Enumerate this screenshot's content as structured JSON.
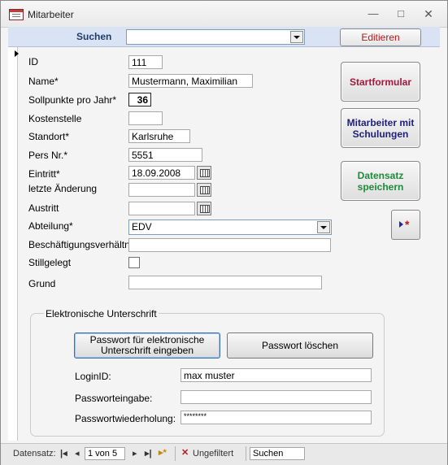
{
  "window": {
    "title": "Mitarbeiter",
    "minimize_glyph": "—",
    "maximize_glyph": "□",
    "close_glyph": "✕"
  },
  "header": {
    "search_label": "Suchen",
    "search_value": "",
    "edit_button": "Editieren"
  },
  "form": {
    "id": {
      "label": "ID",
      "value": "111"
    },
    "name": {
      "label": "Name*",
      "value": "Mustermann, Maximilian"
    },
    "sollpunkte": {
      "label": "Sollpunkte pro Jahr*",
      "value": "36"
    },
    "kostenstelle": {
      "label": "Kostenstelle",
      "value": ""
    },
    "standort": {
      "label": "Standort*",
      "value": "Karlsruhe"
    },
    "persnr": {
      "label": "Pers Nr.*",
      "value": "5551"
    },
    "eintritt": {
      "label": "Eintritt*",
      "value": "18.09.2008"
    },
    "letzte_aenderung": {
      "label": "letzte Änderung",
      "value": ""
    },
    "austritt": {
      "label": "Austritt",
      "value": ""
    },
    "abteilung": {
      "label": "Abteilung*",
      "value": "EDV"
    },
    "beschaeftigung": {
      "label": "Beschäftigungsverhältnis",
      "value": ""
    },
    "stillgelegt": {
      "label": "Stillgelegt",
      "checked": false
    },
    "grund": {
      "label": "Grund",
      "value": ""
    }
  },
  "side_buttons": {
    "startformular": "Startformular",
    "schulungen": "Mitarbeiter mit Schulungen",
    "speichern": "Datensatz speichern",
    "startformular_color": "#a3183c",
    "schulungen_color": "#1e1e7a",
    "speichern_color": "#1f8a3a",
    "new_record_icon": "new-record-icon"
  },
  "signature": {
    "group_title": "Elektronische Unterschrift",
    "enter_password_button": "Passwort für elektronische Unterschrift eingeben",
    "delete_password_button": "Passwort löschen",
    "loginid": {
      "label": "LoginID:",
      "value": "max muster"
    },
    "password": {
      "label": "Passworteingabe:",
      "value": ""
    },
    "password_repeat": {
      "label": "Passwortwiederholung:",
      "value": "********"
    }
  },
  "navigation": {
    "record_label": "Datensatz:",
    "record_position": "1 von 5",
    "filter_status": "Ungefiltert",
    "search_label": "Suchen"
  }
}
